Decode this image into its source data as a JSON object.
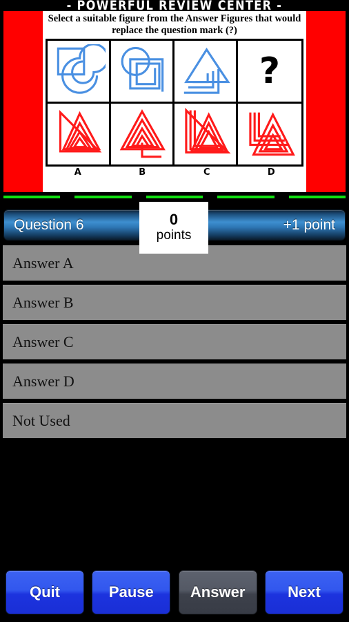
{
  "app": {
    "title": "- POWERFUL REVIEW CENTER -"
  },
  "puzzle": {
    "prompt": "Select a suitable figure from the Answer Figures that would replace the question mark (?)",
    "question_row": [
      {
        "name": "square-with-circle-spiral",
        "type": "figure",
        "color": "#4a90e2"
      },
      {
        "name": "circle-with-square-spiral",
        "type": "figure",
        "color": "#4a90e2"
      },
      {
        "name": "triangle-with-angular-spiral",
        "type": "figure",
        "color": "#4a90e2"
      },
      {
        "name": "question-mark",
        "type": "placeholder",
        "glyph": "?"
      }
    ],
    "answer_row": [
      {
        "label": "A",
        "name": "answer-figure-a",
        "color": "#ff1a1a"
      },
      {
        "label": "B",
        "name": "answer-figure-b",
        "color": "#ff1a1a"
      },
      {
        "label": "C",
        "name": "answer-figure-c",
        "color": "#ff1a1a"
      },
      {
        "label": "D",
        "name": "answer-figure-d",
        "color": "#ff1a1a"
      }
    ],
    "band_color": "#ff0000"
  },
  "progress": {
    "segments": 5,
    "color": "#12e012"
  },
  "status_bar": {
    "question_label": "Question 6",
    "point_label": "+1 point",
    "score_value": "0",
    "score_unit": "points"
  },
  "answers": {
    "options": [
      {
        "label": "Answer A"
      },
      {
        "label": "Answer B"
      },
      {
        "label": "Answer C"
      },
      {
        "label": "Answer D"
      },
      {
        "label": "Not Used"
      }
    ]
  },
  "footer": {
    "buttons": [
      {
        "label": "Quit",
        "style": "blue",
        "name": "quit-button"
      },
      {
        "label": "Pause",
        "style": "blue",
        "name": "pause-button"
      },
      {
        "label": "Answer",
        "style": "gray",
        "name": "answer-button"
      },
      {
        "label": "Next",
        "style": "blue",
        "name": "next-button"
      }
    ]
  }
}
